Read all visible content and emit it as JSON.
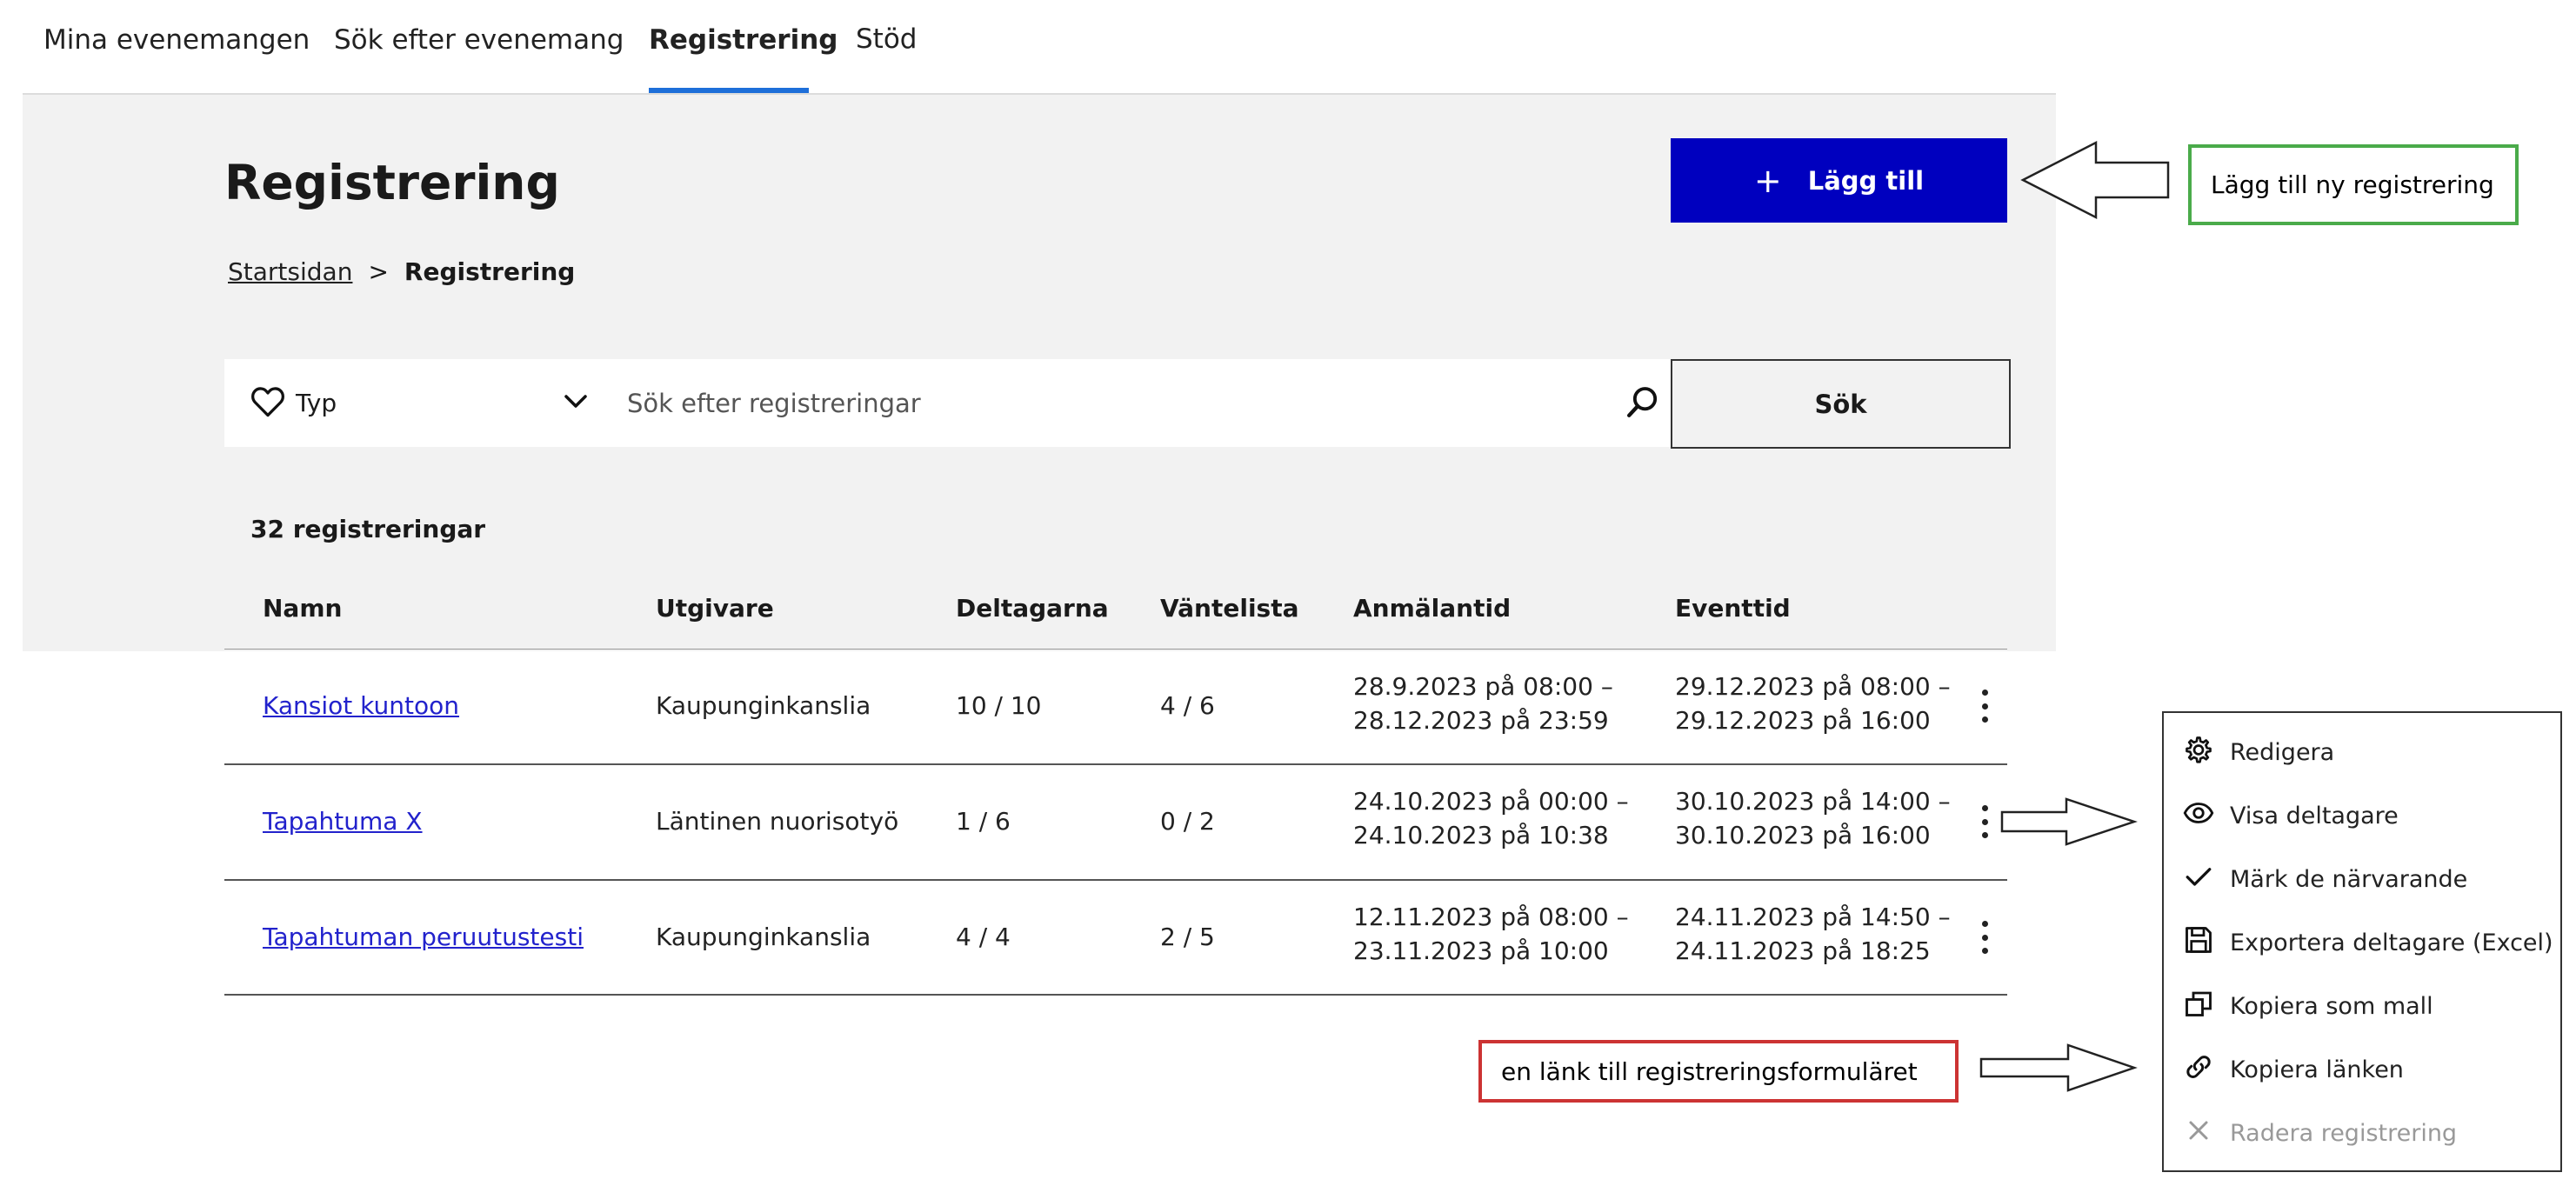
{
  "topnav": {
    "items": [
      "Mina evenemangen",
      "Sök efter evenemang",
      "Registrering",
      "Stöd"
    ],
    "active_index": 2
  },
  "header": {
    "title": "Registrering",
    "add_button_label": "Lägg till"
  },
  "breadcrumb": {
    "home": "Startsidan",
    "separator": ">",
    "current": "Registrering"
  },
  "filters": {
    "type_label": "Typ",
    "search_placeholder": "Sök efter registreringar",
    "search_button_label": "Sök"
  },
  "results": {
    "count_label": "32 registreringar"
  },
  "table": {
    "columns": [
      "Namn",
      "Utgivare",
      "Deltagarna",
      "Väntelista",
      "Anmälantid",
      "Eventtid"
    ],
    "rows": [
      {
        "name": "Kansiot kuntoon",
        "publisher": "Kaupunginkanslia",
        "participants": "10 / 10",
        "waitlist": "4 / 6",
        "registration_time": [
          "28.9.2023 på 08:00 –",
          "28.12.2023 på 23:59"
        ],
        "event_time": [
          "29.12.2023 på 08:00 –",
          "29.12.2023 på 16:00"
        ]
      },
      {
        "name": "Tapahtuma X",
        "publisher": "Läntinen nuorisotyö",
        "participants": "1 / 6",
        "waitlist": "0 / 2",
        "registration_time": [
          "24.10.2023 på 00:00 –",
          "24.10.2023 på 10:38"
        ],
        "event_time": [
          "30.10.2023 på 14:00 –",
          "30.10.2023 på 16:00"
        ]
      },
      {
        "name": "Tapahtuman peruutustesti",
        "publisher": "Kaupunginkanslia",
        "participants": "4 / 4",
        "waitlist": "2 / 5",
        "registration_time": [
          "12.11.2023 på 08:00 –",
          "23.11.2023 på 10:00"
        ],
        "event_time": [
          "24.11.2023 på 14:50 –",
          "24.11.2023 på 18:25"
        ]
      }
    ]
  },
  "context_menu": {
    "items": [
      {
        "label": "Redigera",
        "icon": "gear-icon",
        "disabled": false
      },
      {
        "label": "Visa deltagare",
        "icon": "eye-icon",
        "disabled": false
      },
      {
        "label": "Märk de närvarande",
        "icon": "check-icon",
        "disabled": false
      },
      {
        "label": "Exportera deltagare (Excel)",
        "icon": "save-icon",
        "disabled": false
      },
      {
        "label": "Kopiera som mall",
        "icon": "copy-icon",
        "disabled": false
      },
      {
        "label": "Kopiera länken",
        "icon": "link-icon",
        "disabled": false
      },
      {
        "label": "Radera registrering",
        "icon": "close-icon",
        "disabled": true
      }
    ]
  },
  "annotations": {
    "add_callout": "Lägg till ny registrering",
    "link_callout": "en länk till registreringsformuläret"
  },
  "colors": {
    "primary_button": "#0000bf",
    "active_tab_underline": "#1e6fd9",
    "panel_background": "#f2f2f2",
    "link": "#2222cc",
    "callout_green": "#4aab4a",
    "callout_red": "#cc3333"
  }
}
